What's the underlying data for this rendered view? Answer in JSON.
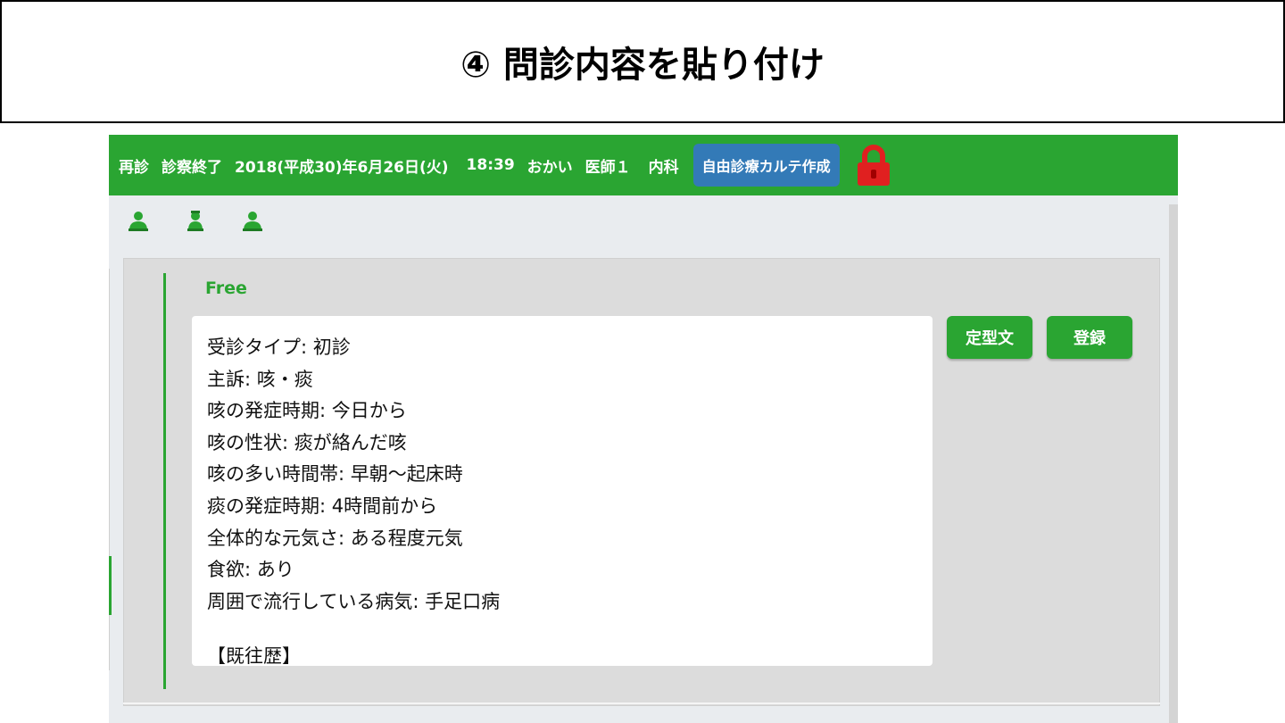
{
  "slide_title": "④ 問診内容を貼り付け",
  "topbar": {
    "visit_type": "再診",
    "status": "診察終了",
    "datetime": "2018(平成30)年6月26日(火)",
    "time": "18:39",
    "patient": "おかい",
    "doctor": "医師１",
    "department": "内科",
    "free_chart_button": "自由診療カルテ作成",
    "lock_icon": "padlock-icon",
    "lock_color": "#e02020"
  },
  "icons": [
    "person-icon",
    "person-icon",
    "person-icon"
  ],
  "panel": {
    "label": "Free",
    "template_button": "定型文",
    "register_button": "登録",
    "lines": [
      "受診タイプ: 初診",
      "主訴: 咳・痰",
      "咳の発症時期: 今日から",
      "咳の性状: 痰が絡んだ咳",
      "咳の多い時間帯: 早朝〜起床時",
      "痰の発症時期: 4時間前から",
      "全体的な元気さ: ある程度元気",
      "食欲: あり",
      "周囲で流行している病気: 手足口病"
    ],
    "partial_line": "【既往歴】"
  },
  "colors": {
    "brand_green": "#2aa532",
    "button_blue": "#337ab7",
    "panel_gray": "#dcdcdc"
  }
}
